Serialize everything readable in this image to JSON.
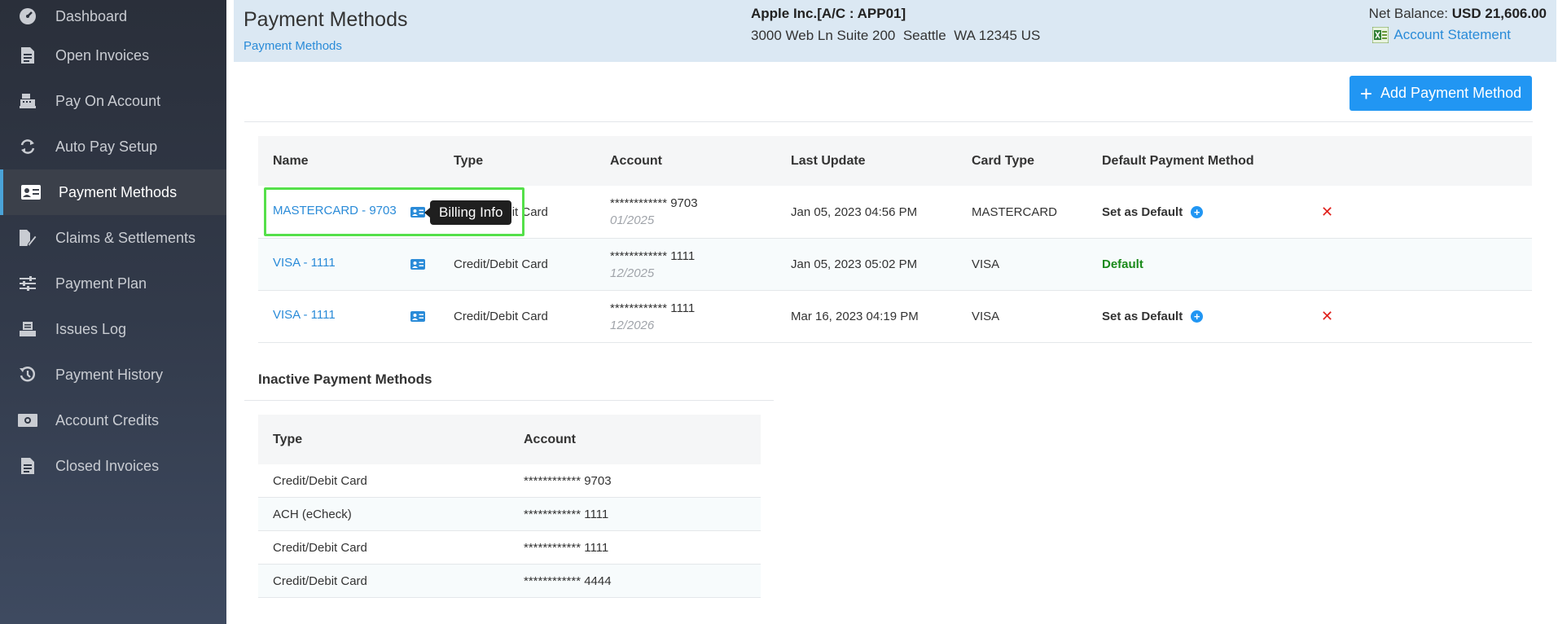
{
  "sidebar": {
    "items": [
      {
        "label": "Dashboard",
        "icon": "dashboard-icon"
      },
      {
        "label": "Open Invoices",
        "icon": "invoice-icon"
      },
      {
        "label": "Pay On Account",
        "icon": "cash-register-icon"
      },
      {
        "label": "Auto Pay Setup",
        "icon": "sync-icon"
      },
      {
        "label": "Payment Methods",
        "icon": "id-card-icon"
      },
      {
        "label": "Claims & Settlements",
        "icon": "file-edit-icon"
      },
      {
        "label": "Payment Plan",
        "icon": "sliders-icon"
      },
      {
        "label": "Issues Log",
        "icon": "inbox-icon"
      },
      {
        "label": "Payment History",
        "icon": "history-icon"
      },
      {
        "label": "Account Credits",
        "icon": "money-bill-icon"
      },
      {
        "label": "Closed Invoices",
        "icon": "document-icon"
      }
    ]
  },
  "header": {
    "title": "Payment Methods",
    "breadcrumb": "Payment Methods",
    "company": "Apple Inc.[A/C : APP01]",
    "address": "3000 Web Ln Suite 200  Seattle  WA 12345 US",
    "balance_label": "Net Balance:",
    "balance_value": "USD 21,606.00",
    "statement_link": "Account Statement"
  },
  "add_button": "Add Payment Method",
  "tooltip": "Billing Info",
  "active_table": {
    "headers": {
      "name": "Name",
      "type": "Type",
      "account": "Account",
      "last_update": "Last Update",
      "card_type": "Card Type",
      "default": "Default Payment Method"
    },
    "rows": [
      {
        "name": "MASTERCARD - 9703",
        "type": "Credit/Debit Card",
        "account": "************ 9703",
        "expiry": "01/2025",
        "last_update": "Jan 05, 2023 04:56 PM",
        "card_type": "MASTERCARD",
        "default": "Set as Default"
      },
      {
        "name": "VISA - 1111",
        "type": "Credit/Debit Card",
        "account": "************ 1111",
        "expiry": "12/2025",
        "last_update": "Jan 05, 2023 05:02 PM",
        "card_type": "VISA",
        "default": "Default"
      },
      {
        "name": "VISA - 1111",
        "type": "Credit/Debit Card",
        "account": "************ 1111",
        "expiry": "12/2026",
        "last_update": "Mar 16, 2023 04:19 PM",
        "card_type": "VISA",
        "default": "Set as Default"
      }
    ]
  },
  "inactive": {
    "title": "Inactive Payment Methods",
    "headers": {
      "type": "Type",
      "account": "Account"
    },
    "rows": [
      {
        "type": "Credit/Debit Card",
        "account": "************ 9703"
      },
      {
        "type": "ACH (eCheck)",
        "account": "************ 1111"
      },
      {
        "type": "Credit/Debit Card",
        "account": "************ 1111"
      },
      {
        "type": "Credit/Debit Card",
        "account": "************ 4444"
      }
    ]
  },
  "colors": {
    "accent": "#2196f3",
    "link": "#2a8bd8",
    "default_green": "#1a8a1a",
    "delete_red": "#e0201b",
    "highlight": "#55e04a"
  }
}
